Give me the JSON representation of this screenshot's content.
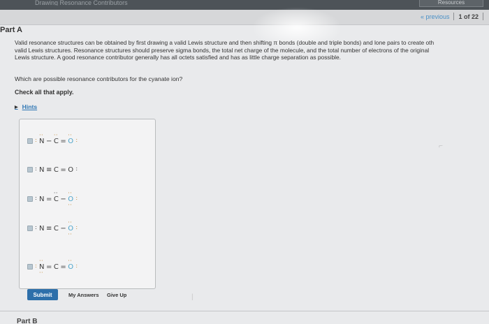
{
  "topbar": {
    "faded_tab": "Drawing Resonance Contributors",
    "resources_label": "Resources"
  },
  "nav": {
    "previous_label": "« previous",
    "page_count": "1 of 22"
  },
  "part": {
    "title": "Part A"
  },
  "intro": [
    "Valid resonance structures can be obtained by first drawing a valid Lewis structure and then shifting π bonds (double and triple bonds) and lone pairs to create oth",
    "valid Lewis structures. Resonance structures should preserve sigma bonds, the total net charge of the molecule, and the total number of electrons of the original",
    "Lewis structure. A good resonance contributor generally has all octets satisfied and has as little charge separation as possible."
  ],
  "question": "Which are possible resonance contributors for the cyanate ion?",
  "check_all": "Check all that apply.",
  "hints_label": "Hints",
  "options": [
    {
      "n": "N",
      "b1": "−",
      "c": "C",
      "b2": "=",
      "o": "O"
    },
    {
      "n": "N",
      "b1": "≡",
      "c": "C",
      "b2": "=",
      "o": "O"
    },
    {
      "n": "N",
      "b1": "=",
      "c": "C",
      "b2": "−",
      "o": "O"
    },
    {
      "n": "N",
      "b1": "≡",
      "c": "C",
      "b2": "−",
      "o": "O"
    },
    {
      "n": "N",
      "b1": "=",
      "c": "C",
      "b2": "=",
      "o": "O"
    }
  ],
  "lone_pair_glyphs": {
    "pair_h": "··",
    "pair_v": ":"
  },
  "buttons": {
    "submit": "Submit",
    "my_answers": "My Answers",
    "give_up": "Give Up"
  },
  "next_part": "Part B",
  "colors": {
    "accent": "#2d6faa",
    "link": "#2e76b4",
    "oxygen": "#4aa3c9",
    "lone_pair": "#c2842d",
    "checkbox": "#b7c6d0"
  }
}
